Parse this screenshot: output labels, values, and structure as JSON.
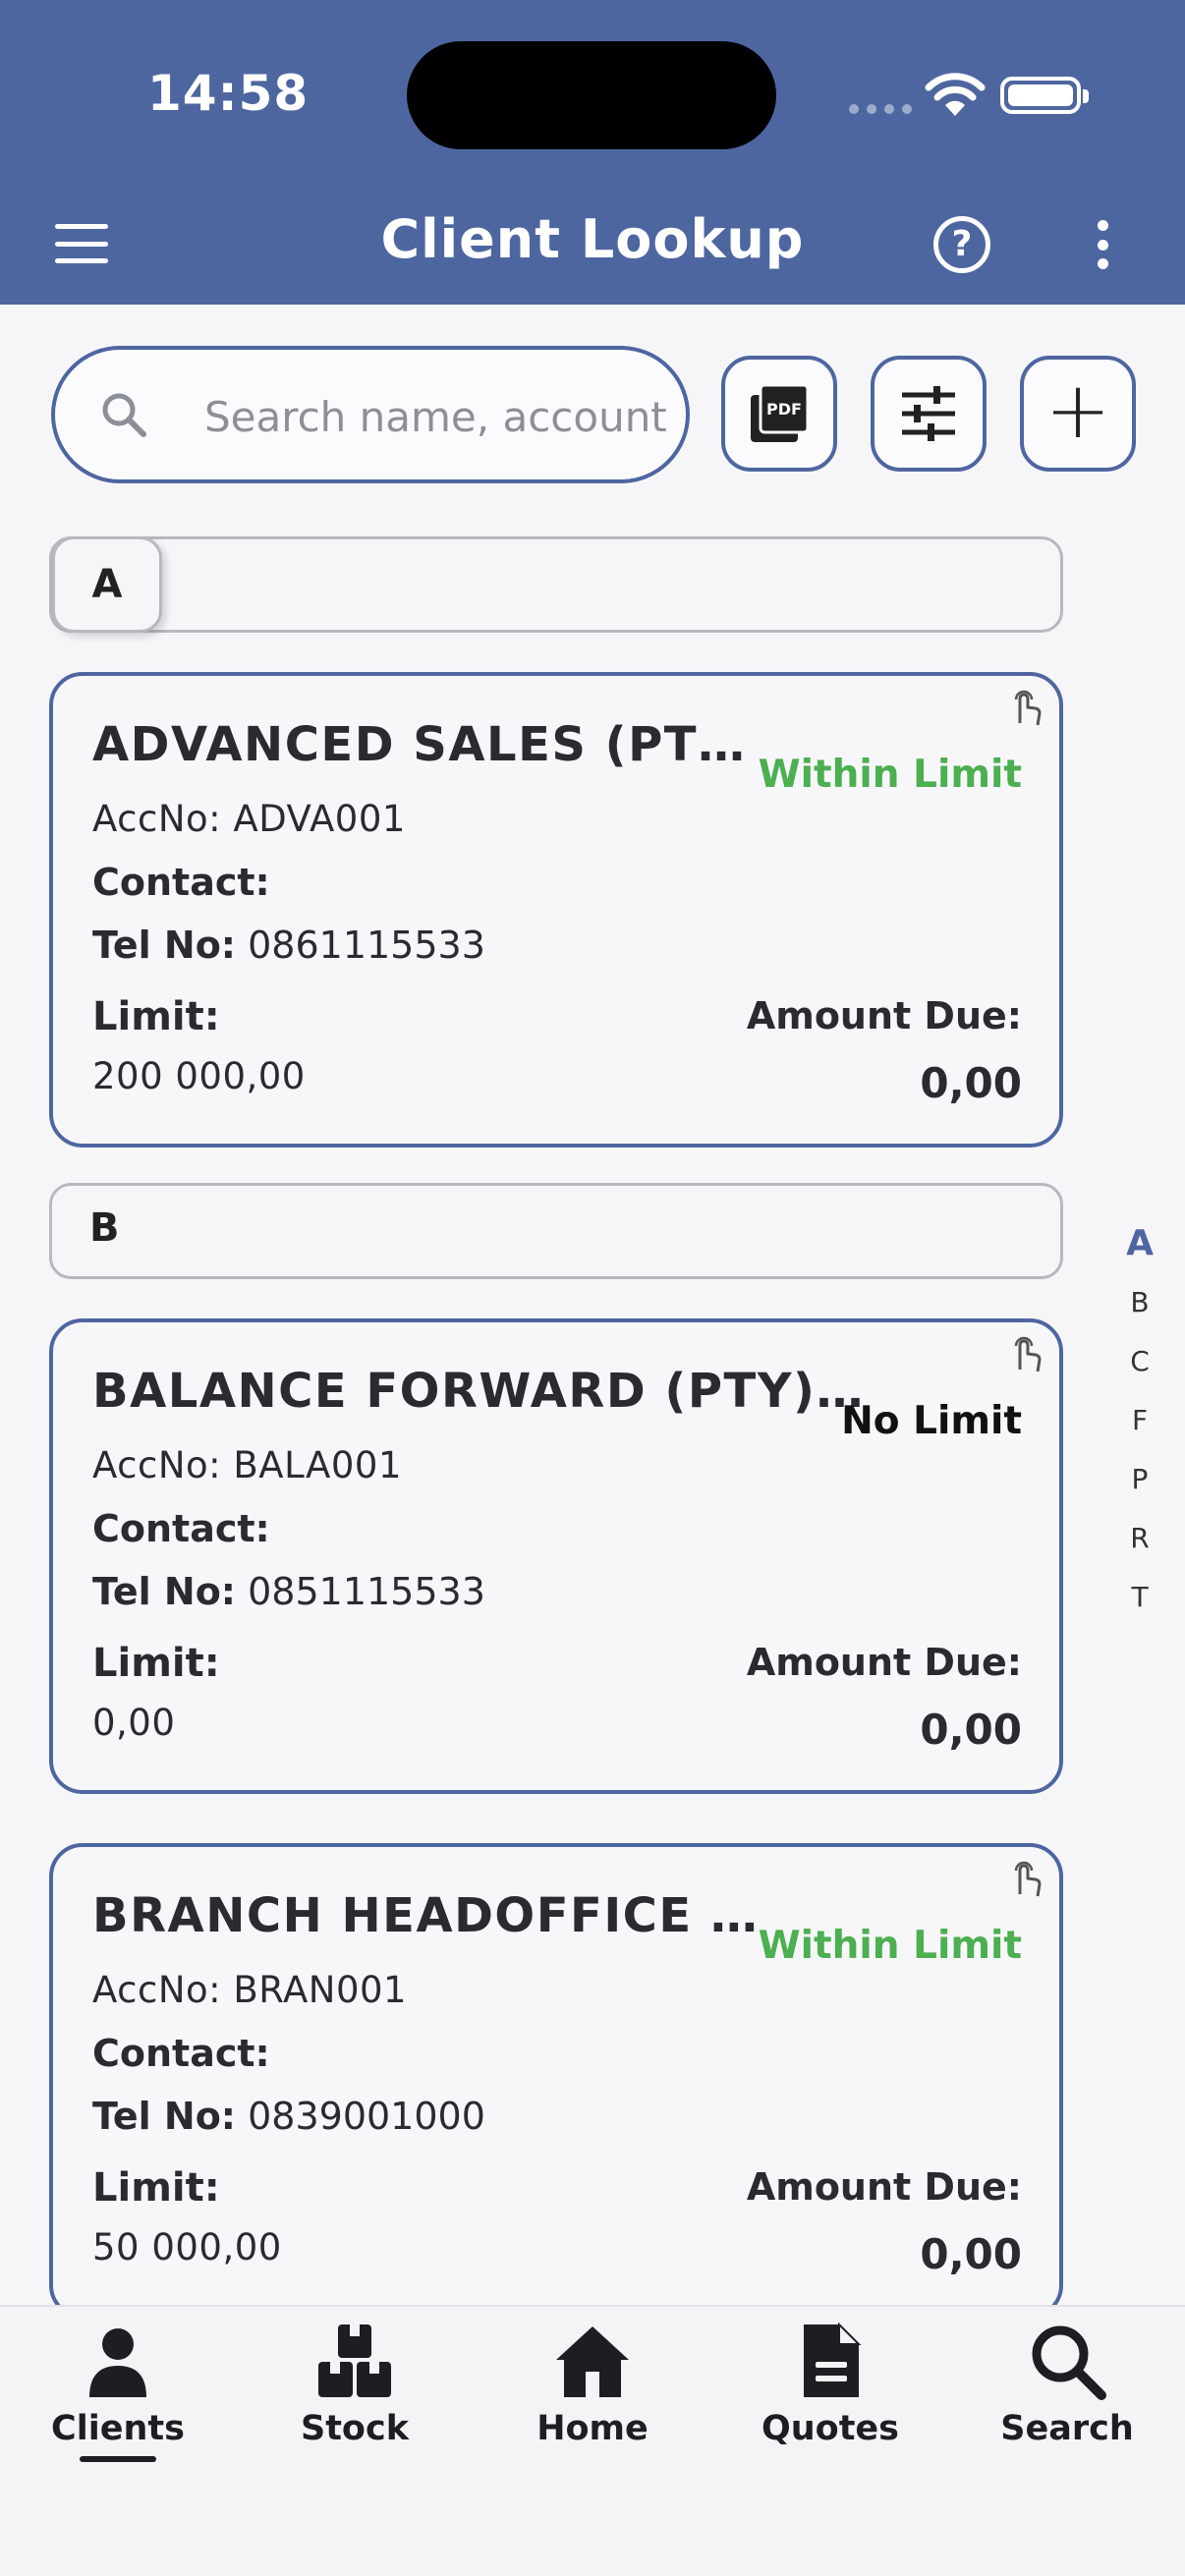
{
  "status_bar": {
    "time": "14:58"
  },
  "app_bar": {
    "title": "Client Lookup"
  },
  "search": {
    "placeholder": "Search name, account..."
  },
  "toolbar": {
    "pdf_label": "PDF",
    "add_label": "+"
  },
  "sections": [
    {
      "letter": "A"
    },
    {
      "letter": "B"
    }
  ],
  "labels": {
    "contact": "Contact:",
    "tel": "Tel No:",
    "limit": "Limit:",
    "amount_due": "Amount Due:"
  },
  "clients": [
    {
      "name": "ADVANCED SALES (PTY) LTD",
      "acc": "AccNo: ADVA001",
      "contact": "",
      "tel": "0861115533",
      "limit": "200 000,00",
      "amount_due": "0,00",
      "status": "Within Limit",
      "status_color": "#4caf50"
    },
    {
      "name": "BALANCE FORWARD (PTY) LTD",
      "acc": "AccNo: BALA001",
      "contact": "",
      "tel": "0851115533",
      "limit": "0,00",
      "amount_due": "0,00",
      "status": "No Limit",
      "status_color": "#111111"
    },
    {
      "name": "BRANCH HEADOFFICE (PTY) LTD",
      "acc": "AccNo: BRAN001",
      "contact": "",
      "tel": "0839001000",
      "limit": "50 000,00",
      "amount_due": "0,00",
      "status": "Within Limit",
      "status_color": "#4caf50"
    }
  ],
  "alpha_index": [
    "A",
    "B",
    "C",
    "F",
    "P",
    "R",
    "T"
  ],
  "bottom_nav": [
    {
      "label": "Clients",
      "icon": "person-icon",
      "active": true
    },
    {
      "label": "Stock",
      "icon": "boxes-icon"
    },
    {
      "label": "Home",
      "icon": "home-icon"
    },
    {
      "label": "Quotes",
      "icon": "document-icon"
    },
    {
      "label": "Search",
      "icon": "search-icon"
    }
  ],
  "colors": {
    "primary": "#4e66a0",
    "within_limit": "#4caf50"
  }
}
